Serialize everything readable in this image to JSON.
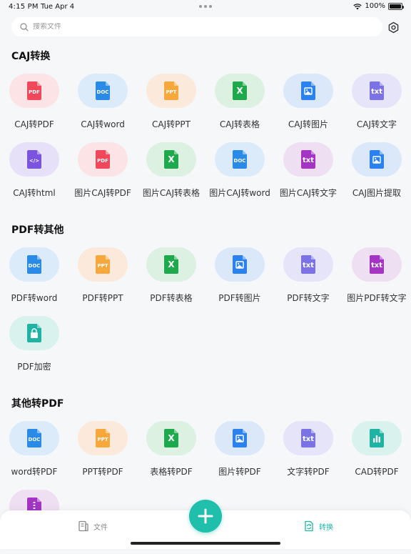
{
  "status": {
    "time": "4:15 PM",
    "date": "Tue Apr 4",
    "battery": "100%"
  },
  "search": {
    "placeholder": "搜索文件"
  },
  "sections": [
    {
      "title": "CAJ转换",
      "items": [
        {
          "label": "CAJ转PDF",
          "icon": "pdf",
          "tag": "PDF",
          "bg": "#fbe3e6",
          "color": "#f1475b"
        },
        {
          "label": "CAJ转word",
          "icon": "doc",
          "tag": "DOC",
          "bg": "#dcebf9",
          "color": "#2a8ae8"
        },
        {
          "label": "CAJ转PPT",
          "icon": "ppt",
          "tag": "PPT",
          "bg": "#fbeadb",
          "color": "#f6a83c"
        },
        {
          "label": "CAJ转表格",
          "icon": "xls",
          "tag": "X",
          "bg": "#dcf1e2",
          "color": "#1eaa4c"
        },
        {
          "label": "CAJ转图片",
          "icon": "img",
          "tag": "",
          "bg": "#dbe8fa",
          "color": "#2b82ef"
        },
        {
          "label": "CAJ转文字",
          "icon": "txt",
          "tag": "txt",
          "bg": "#e6e4f8",
          "color": "#7b72e6"
        },
        {
          "label": "CAJ转html",
          "icon": "html",
          "tag": "</>",
          "bg": "#e6e1f8",
          "color": "#7a54e0"
        },
        {
          "label": "图片CAJ转PDF",
          "icon": "pdf",
          "tag": "PDF",
          "bg": "#fbe3e6",
          "color": "#f1475b"
        },
        {
          "label": "图片CAJ转表格",
          "icon": "xls",
          "tag": "X",
          "bg": "#dcf1e2",
          "color": "#1eaa4c"
        },
        {
          "label": "图片CAJ转word",
          "icon": "doc",
          "tag": "DOC",
          "bg": "#dcebf9",
          "color": "#2a8ae8"
        },
        {
          "label": "图片CAJ转文字",
          "icon": "txt",
          "tag": "txt",
          "bg": "#efdff3",
          "color": "#a334c4"
        },
        {
          "label": "CAJ图片提取",
          "icon": "img",
          "tag": "",
          "bg": "#dbe8fa",
          "color": "#2b82ef"
        }
      ]
    },
    {
      "title": "PDF转其他",
      "items": [
        {
          "label": "PDF转word",
          "icon": "doc",
          "tag": "DOC",
          "bg": "#dcebf9",
          "color": "#2a8ae8"
        },
        {
          "label": "PDF转PPT",
          "icon": "ppt",
          "tag": "PPT",
          "bg": "#fbeadb",
          "color": "#f6a83c"
        },
        {
          "label": "PDF转表格",
          "icon": "xls",
          "tag": "X",
          "bg": "#dcf1e2",
          "color": "#1eaa4c"
        },
        {
          "label": "PDF转图片",
          "icon": "img",
          "tag": "",
          "bg": "#dbe8fa",
          "color": "#2b82ef"
        },
        {
          "label": "PDF转文字",
          "icon": "txt",
          "tag": "txt",
          "bg": "#e6e4f8",
          "color": "#7b72e6"
        },
        {
          "label": "图片PDF转文字",
          "icon": "txt",
          "tag": "txt",
          "bg": "#efdff3",
          "color": "#a334c4"
        },
        {
          "label": "PDF加密",
          "icon": "lock",
          "tag": "",
          "bg": "#d9f2ee",
          "color": "#1fb3a4"
        }
      ]
    },
    {
      "title": "其他转PDF",
      "items": [
        {
          "label": "word转PDF",
          "icon": "doc",
          "tag": "DOC",
          "bg": "#dcebf9",
          "color": "#2a8ae8"
        },
        {
          "label": "PPT转PDF",
          "icon": "ppt",
          "tag": "PPT",
          "bg": "#fbeadb",
          "color": "#f6a83c"
        },
        {
          "label": "表格转PDF",
          "icon": "xls",
          "tag": "X",
          "bg": "#dcf1e2",
          "color": "#1eaa4c"
        },
        {
          "label": "图片转PDF",
          "icon": "img",
          "tag": "",
          "bg": "#dbe8fa",
          "color": "#2b82ef"
        },
        {
          "label": "文字转PDF",
          "icon": "txt",
          "tag": "txt",
          "bg": "#e6e4f8",
          "color": "#7b72e6"
        },
        {
          "label": "CAD转PDF",
          "icon": "chart",
          "tag": "",
          "bg": "#d9f2ee",
          "color": "#1fb3a4"
        },
        {
          "label": "",
          "icon": "zip",
          "tag": "",
          "bg": "#efdff3",
          "color": "#a334c4"
        }
      ]
    }
  ],
  "tabs": {
    "files": "文件",
    "convert": "转换"
  },
  "colors": {
    "accent": "#1fbfac",
    "tab_active": "#1fb6a6",
    "tab_inactive": "#888888"
  }
}
